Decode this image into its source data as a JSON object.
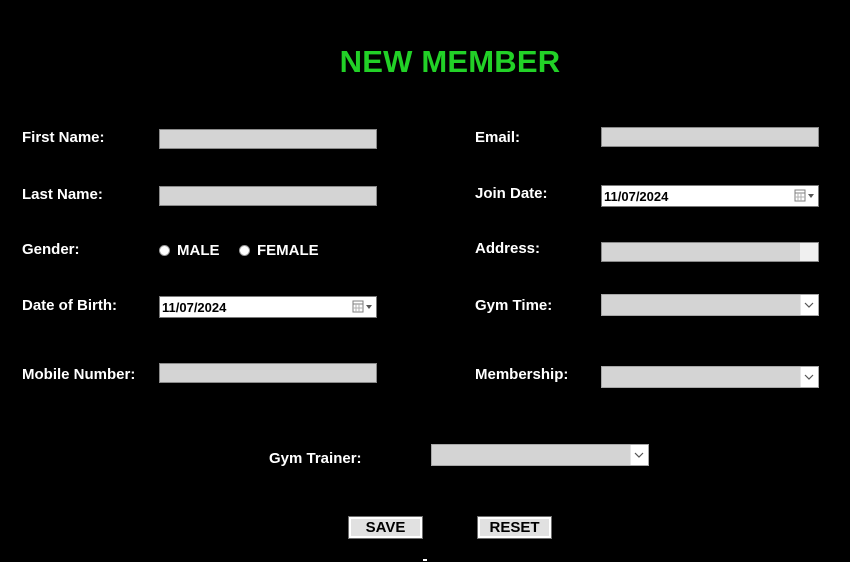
{
  "title": "NEW MEMBER",
  "labels": {
    "first_name": "First Name:",
    "last_name": "Last Name:",
    "gender": "Gender:",
    "dob": "Date of Birth:",
    "mobile": "Mobile Number:",
    "email": "Email:",
    "join_date": "Join Date:",
    "address": "Address:",
    "gym_time": "Gym Time:",
    "membership": "Membership:",
    "gym_trainer": "Gym Trainer:"
  },
  "fields": {
    "first_name": "",
    "last_name": "",
    "mobile": "",
    "email": "",
    "address": "",
    "dob": "11/07/2024",
    "join_date": "11/07/2024",
    "gym_time": "",
    "membership": "",
    "gym_trainer": ""
  },
  "gender_options": {
    "male": "MALE",
    "female": "FEMALE"
  },
  "buttons": {
    "save": "SAVE",
    "reset": "RESET"
  },
  "icons": {
    "calendar": "calendar-icon",
    "dropdown": "chevron-down-icon"
  },
  "colors": {
    "title": "#22d127",
    "background": "#000000",
    "field": "#d4d4d4"
  }
}
